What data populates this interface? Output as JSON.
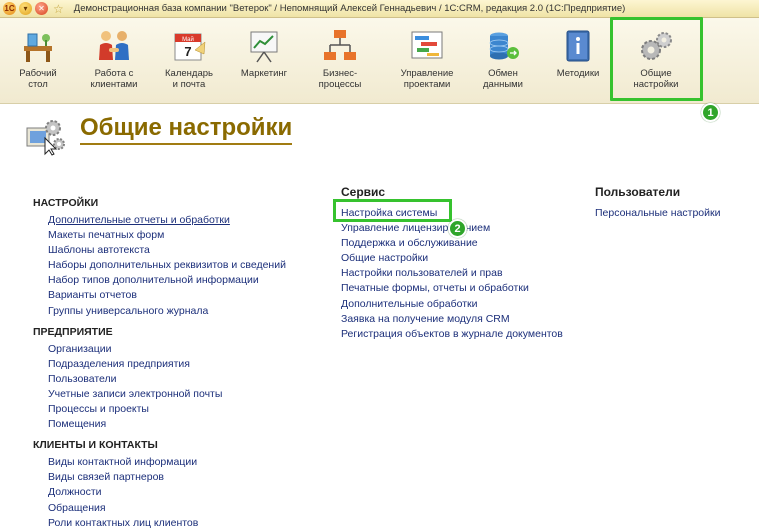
{
  "window": {
    "title": "Демонстрационная база компании \"Ветерок\" / Непомнящий Алексей Геннадьевич / 1С:CRM, редакция 2.0  (1С:Предприятие)",
    "logo_text": "1С"
  },
  "toolbar": {
    "items": [
      {
        "label": "Рабочий стол"
      },
      {
        "label": "Работа с клиентами"
      },
      {
        "label": "Календарь и почта"
      },
      {
        "label": "Маркетинг"
      },
      {
        "label": "Бизнес-процессы"
      },
      {
        "label": "Управление проектами"
      },
      {
        "label": "Обмен данными"
      },
      {
        "label": "Методики"
      },
      {
        "label": "Общие настройки"
      }
    ]
  },
  "callouts": {
    "one": "1",
    "two": "2"
  },
  "page": {
    "title": "Общие настройки"
  },
  "columns": {
    "left": {
      "sections": [
        {
          "title": "НАСТРОЙКИ",
          "links": [
            "Дополнительные отчеты и обработки",
            "Макеты печатных форм",
            "Шаблоны автотекста",
            "Наборы дополнительных реквизитов и сведений",
            "Набор типов дополнительной информации",
            "Варианты отчетов",
            "Группы универсального журнала"
          ]
        },
        {
          "title": "ПРЕДПРИЯТИЕ",
          "links": [
            "Организации",
            "Подразделения предприятия",
            "Пользователи",
            "Учетные записи электронной почты",
            "Процессы и проекты",
            "Помещения"
          ]
        },
        {
          "title": "КЛИЕНТЫ И КОНТАКТЫ",
          "links": [
            "Виды контактной информации",
            "Виды связей партнеров",
            "Должности",
            "Обращения",
            "Роли контактных лиц клиентов"
          ]
        }
      ]
    },
    "middle": {
      "title": "Сервис",
      "links": [
        "Настройка системы",
        "Управление лицензированием",
        "Поддержка и обслуживание",
        "Общие настройки",
        "Настройки пользователей и прав",
        "Печатные формы, отчеты и обработки",
        "Дополнительные обработки",
        "Заявка на получение модуля CRM",
        "Регистрация объектов в журнале документов"
      ]
    },
    "right": {
      "title": "Пользователи",
      "links": [
        "Персональные настройки"
      ]
    }
  }
}
